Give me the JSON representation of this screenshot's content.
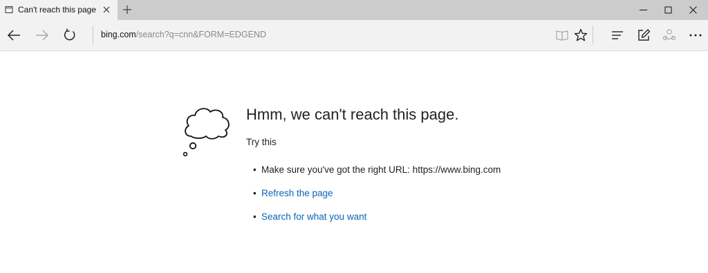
{
  "tab": {
    "title": "Can't reach this page"
  },
  "address": {
    "host": "bing.com",
    "path": "/search?q=cnn&FORM=EDGEND"
  },
  "error": {
    "heading": "Hmm, we can't reach this page.",
    "try_this": "Try this",
    "items": [
      {
        "text": "Make sure you've got the right URL: https://www.bing.com",
        "is_link": false
      },
      {
        "text": "Refresh the page",
        "is_link": true
      },
      {
        "text": "Search for what you want",
        "is_link": true
      }
    ],
    "bullet": "•"
  },
  "icons": {
    "tab": "page-icon",
    "close": "close-icon",
    "new_tab": "plus-icon",
    "back": "back-arrow-icon",
    "forward": "forward-arrow-icon",
    "refresh": "refresh-icon",
    "reading_view": "book-icon",
    "favorite": "star-icon",
    "hub": "hub-icon",
    "note": "web-note-icon",
    "share": "share-icon",
    "more": "more-icon",
    "error": "thought-cloud-icon"
  },
  "colors": {
    "link": "#0a63b8",
    "titlebar": "#cccccc",
    "toolbar": "#f2f2f2"
  }
}
